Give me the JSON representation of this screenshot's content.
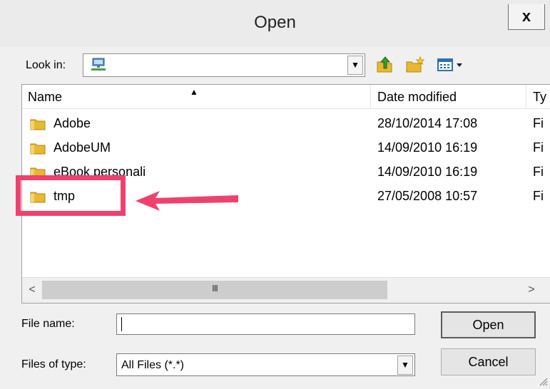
{
  "window": {
    "title": "Open",
    "close_label": "x"
  },
  "toolbar": {
    "look_in_label": "Look in:",
    "look_in_value_icon": "network-computer-icon",
    "buttons": [
      "up-folder-icon",
      "new-folder-icon",
      "view-menu-icon"
    ]
  },
  "file_list": {
    "columns": [
      "Name",
      "Date modified",
      "Ty"
    ],
    "rows": [
      {
        "name": "Adobe",
        "date": "28/10/2014 17:08",
        "type": "Fi"
      },
      {
        "name": "AdobeUM",
        "date": "14/09/2010 16:19",
        "type": "Fi"
      },
      {
        "name": "eBook personali",
        "date": "14/09/2010 16:19",
        "type": "Fi"
      },
      {
        "name": "tmp",
        "date": "27/05/2008 10:57",
        "type": "Fi"
      }
    ],
    "highlighted_row": "tmp",
    "scroll_grip": "III",
    "scroll_left": "<",
    "scroll_right": ">"
  },
  "form": {
    "file_name_label": "File name:",
    "file_name_value": "",
    "files_of_type_label": "Files of type:",
    "files_of_type_value": "All Files (*.*)",
    "open_button": "Open",
    "cancel_button": "Cancel"
  },
  "colors": {
    "highlight": "#f0416e",
    "folder": "#e8b830"
  }
}
